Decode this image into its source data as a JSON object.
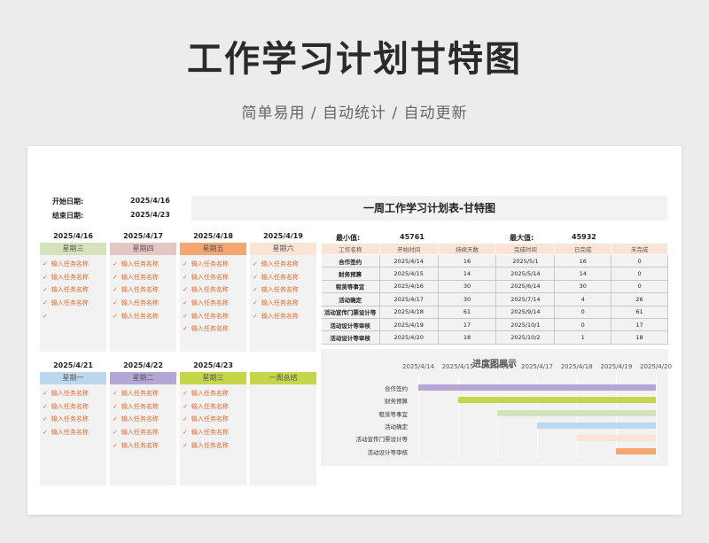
{
  "header": {
    "title": "工作学习计划甘特图",
    "subtitle": "简单易用  /  自动统计  /  自动更新"
  },
  "meta": {
    "start_label": "开始日期:",
    "start_value": "2025/4/16",
    "end_label": "结束日期:",
    "end_value": "2025/4/23"
  },
  "days_row1": [
    {
      "date": "2025/4/16",
      "weekday": "星期三",
      "color": "#d4e3bb",
      "tasks": [
        "输入任务名称",
        "输入任务名称",
        "输入任务名称",
        "输入任务名称",
        ""
      ]
    },
    {
      "date": "2025/4/17",
      "weekday": "星期四",
      "color": "#e6c6c3",
      "tasks": [
        "输入任务名称",
        "输入任务名称",
        "输入任务名称",
        "输入任务名称",
        "输入任务名称"
      ]
    },
    {
      "date": "2025/4/18",
      "weekday": "星期五",
      "color": "#f5a773",
      "tasks": [
        "输入任务名称",
        "输入任务名称",
        "输入任务名称",
        "输入任务名称",
        "输入任务名称",
        "输入任务名称"
      ]
    },
    {
      "date": "2025/4/19",
      "weekday": "星期六",
      "color": "#fbe3d6",
      "tasks": [
        "输入任务名称",
        "输入任务名称",
        "输入任务名称",
        "输入任务名称",
        "输入任务名称"
      ]
    }
  ],
  "days_row2": [
    {
      "date": "2025/4/21",
      "weekday": "星期一",
      "color": "#bdd7ee",
      "tasks": [
        "输入任务名称",
        "输入任务名称",
        "输入任务名称",
        "输入任务名称"
      ]
    },
    {
      "date": "2025/4/22",
      "weekday": "星期二",
      "color": "#b4a7d6",
      "tasks": [
        "输入任务名称",
        "输入任务名称",
        "输入任务名称",
        "输入任务名称",
        "输入任务名称"
      ]
    },
    {
      "date": "2025/4/23",
      "weekday": "星期三",
      "color": "#c5d64b",
      "tasks": [
        "输入任务名称",
        "输入任务名称",
        "输入任务名称",
        "输入任务名称",
        "输入任务名称"
      ]
    },
    {
      "date": "",
      "weekday": "一周总结",
      "color": "#c5d64b",
      "tasks": []
    }
  ],
  "table": {
    "title": "一周工作学习计划表-甘特图",
    "min_label": "最小值:",
    "min_value": "45761",
    "max_label": "最大值:",
    "max_value": "45932",
    "columns": [
      "工作名称",
      "开始时间",
      "持续天数",
      "完成时间",
      "已完成",
      "未完成"
    ],
    "rows": [
      [
        "合作签约",
        "2025/4/14",
        "16",
        "2025/5/1",
        "16",
        "0"
      ],
      [
        "财务预算",
        "2025/4/15",
        "14",
        "2025/5/14",
        "14",
        "0"
      ],
      [
        "租赁等事宜",
        "2025/4/16",
        "30",
        "2025/6/14",
        "30",
        "0"
      ],
      [
        "活动确定",
        "2025/4/17",
        "30",
        "2025/7/14",
        "4",
        "26"
      ],
      [
        "活动宣传门票设计等",
        "2025/4/18",
        "61",
        "2025/9/14",
        "0",
        "61"
      ],
      [
        "活动设计等审核",
        "2025/4/19",
        "17",
        "2025/10/1",
        "0",
        "17"
      ],
      [
        "活动设计等审核",
        "2025/4/20",
        "18",
        "2025/10/2",
        "1",
        "18"
      ]
    ]
  },
  "chart_data": {
    "type": "bar",
    "title": "进度图展示",
    "x_ticks": [
      "2025/4/14",
      "2025/4/15",
      "2025/4/16",
      "2025/4/17",
      "2025/4/18",
      "2025/4/19",
      "2025/4/20"
    ],
    "categories": [
      "合作签约",
      "财务预算",
      "租赁等事宜",
      "活动确定",
      "活动宣传门票设计等",
      "活动设计等审核"
    ],
    "starts": [
      "2025/4/14",
      "2025/4/15",
      "2025/4/16",
      "2025/4/17",
      "2025/4/18",
      "2025/4/19"
    ],
    "colors": [
      "#b4a7d6",
      "#c5d64b",
      "#d4e3bb",
      "#bdd7ee",
      "#fbe3d6",
      "#f5a773"
    ],
    "xlim": [
      "2025/4/14",
      "2025/4/20"
    ]
  }
}
